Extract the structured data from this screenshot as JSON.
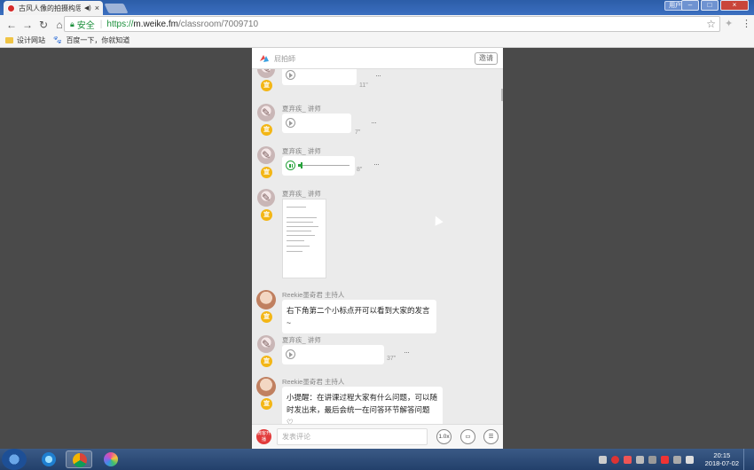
{
  "browser": {
    "tab_title": "古风人像的拍摄构思",
    "tab_mute_icon": "◀)",
    "tab_close": "×",
    "user_label": "用户1",
    "win_min": "–",
    "win_max": "□",
    "win_close": "×",
    "secure_label": "安全",
    "url_proto": "https://",
    "url_host": "m.weike.fm",
    "url_path": "/classroom/7009710",
    "bookmarks": [
      {
        "label": "设计网站",
        "icon": "folder-icon"
      },
      {
        "label": "百度一下，你就知道",
        "icon": "paw-icon"
      }
    ]
  },
  "room": {
    "header_title": "屁拍師",
    "invite_label": "邀请",
    "badge_text": "宣",
    "messages": [
      {
        "type": "voice",
        "speaker": "",
        "duration": "11\"",
        "state": "paused"
      },
      {
        "type": "voice",
        "speaker": "夏弃疾_ 讲师",
        "duration": "7\"",
        "state": "paused"
      },
      {
        "type": "voice",
        "speaker": "夏弃疾_ 讲师",
        "duration": "8\"",
        "state": "playing",
        "progress": 0.05
      },
      {
        "type": "image",
        "speaker": "夏弃疾_ 讲师"
      },
      {
        "type": "text",
        "speaker": "Reekie墨奇君 主持人",
        "text": "右下角第二个小标点开可以看到大家的发言~"
      },
      {
        "type": "voice",
        "speaker": "夏弃疾_ 讲师",
        "duration": "37\"",
        "state": "paused"
      },
      {
        "type": "text",
        "speaker": "Reekie墨奇君 主持人",
        "text": "小提醒：在讲课过程大家有什么问题，可以随时发出来，最后会统一在问答环节解答问题 ♡"
      }
    ],
    "input": {
      "avatar_text": "微客开播",
      "placeholder": "发表评论",
      "speed_label": "1.0x"
    }
  },
  "taskbar": {
    "time": "20:15",
    "date": "2018-07-02"
  }
}
